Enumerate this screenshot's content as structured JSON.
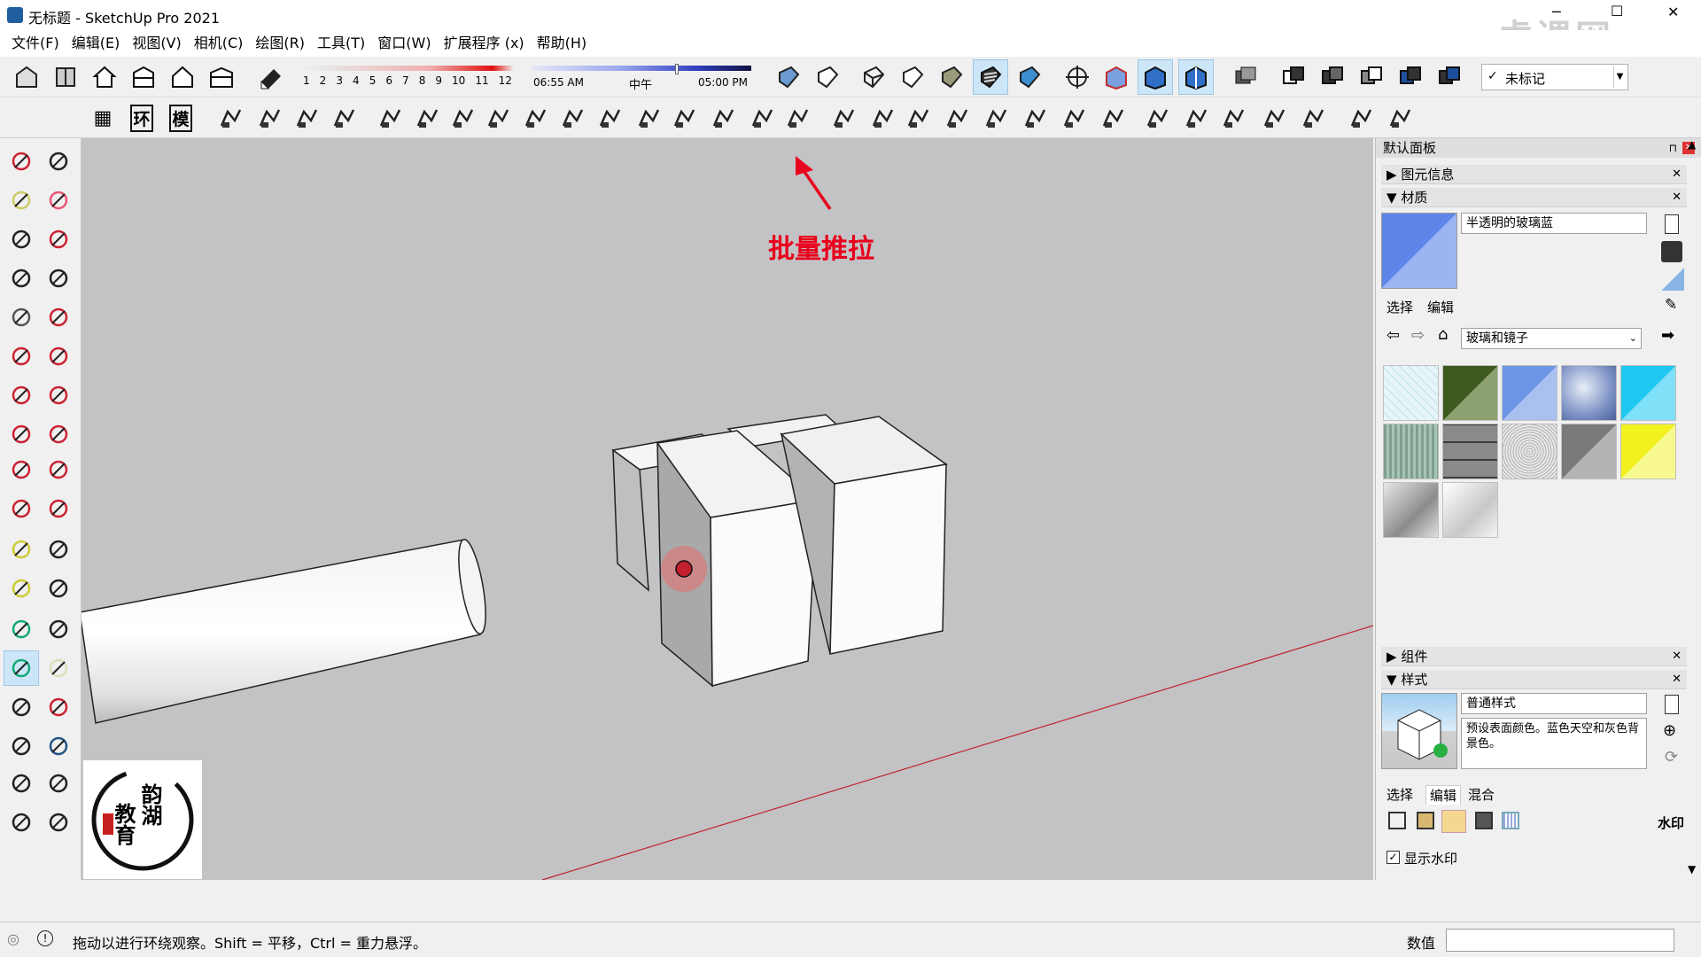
{
  "window": {
    "title": "无标题 - SketchUp Pro 2021",
    "app_icon": "sketchup-icon",
    "minimize_symbol": "─",
    "maximize_symbol": "☐",
    "close_symbol": "✕",
    "watermark": "虎课网"
  },
  "menu": [
    "文件(F)",
    "编辑(E)",
    "视图(V)",
    "相机(C)",
    "绘图(R)",
    "工具(T)",
    "窗口(W)",
    "扩展程序 (x)",
    "帮助(H)"
  ],
  "shadow_bar": {
    "months": [
      "1",
      "2",
      "3",
      "4",
      "5",
      "6",
      "7",
      "8",
      "9",
      "10",
      "11",
      "12"
    ],
    "time_start": "06:55 AM",
    "time_mid": "中午",
    "time_end": "05:00 PM"
  },
  "tag_dropdown": {
    "check": "✓",
    "value": "未标记"
  },
  "toolbar2_labels": {
    "b1": "▦",
    "b2": "环",
    "b3": "模"
  },
  "annotation": {
    "text": "批量推拉",
    "color": "#e8001c"
  },
  "logo": {
    "line1": "韵湖",
    "line2": "教育"
  },
  "panel": {
    "title": "默认面板",
    "entity_info": "图元信息",
    "materials": "材质",
    "material_name": "半透明的玻璃蓝",
    "tabs": [
      "选择",
      "编辑"
    ],
    "library": "玻璃和镜子",
    "swatch_colors": [
      "#d9eef3",
      "#3d5a1e",
      "#6e96e6",
      "#7f94c6",
      "#1ec8f0",
      "#8aaa96",
      "#5c5c5c",
      "#9a9a9a",
      "#7a7a7a",
      "#f2f21e",
      "#9a9a9a",
      "#c8c8c8"
    ],
    "components": "组件",
    "styles": "样式",
    "style_name": "普通样式",
    "style_desc": "预设表面颜色。蓝色天空和灰色背景色。",
    "style_tabs": [
      "选择",
      "编辑",
      "混合"
    ],
    "watermark_label": "水印",
    "show_watermark": "显示水印"
  },
  "status": {
    "message": "拖动以进行环绕观察。Shift = 平移，Ctrl = 重力悬浮。",
    "value_label": "数值",
    "value": ""
  },
  "colors": {
    "viewport_bg": "#c3c3c6",
    "axis_red": "#c0242c",
    "selection_blue": "#cde6f7"
  }
}
